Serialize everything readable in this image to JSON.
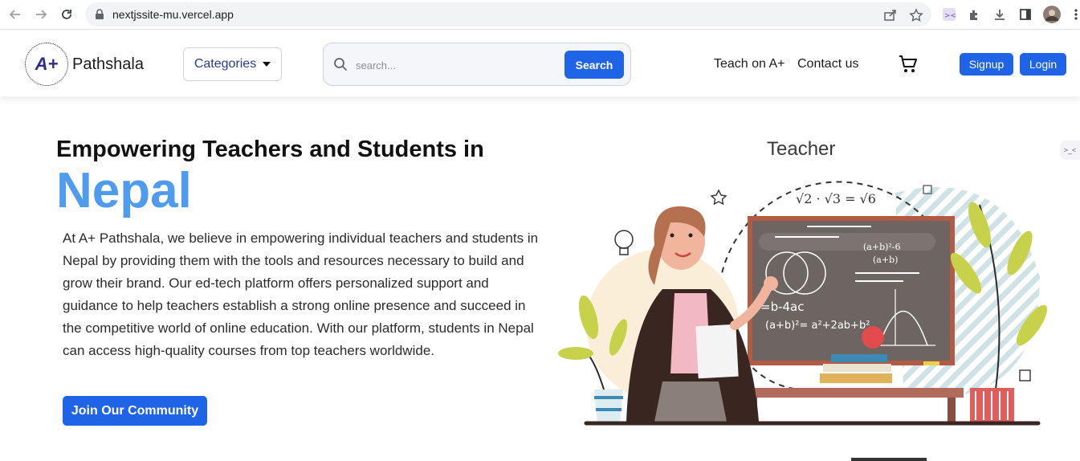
{
  "browser": {
    "url": "nextjssite-mu.vercel.app",
    "icons": [
      "back-icon",
      "forward-icon",
      "reload-icon",
      "lock-icon",
      "share-icon",
      "star-icon",
      "extension-icon",
      "puzzle-icon",
      "download-icon",
      "sidepanel-icon",
      "profile-avatar",
      "menu-icon"
    ]
  },
  "header": {
    "logo_text": "A+",
    "brand": "Pathshala",
    "categories_label": "Categories",
    "search_placeholder": "search...",
    "search_button": "Search",
    "nav": {
      "teach": "Teach on A+",
      "contact": "Contact us"
    },
    "signup": "Signup",
    "login": "Login"
  },
  "hero": {
    "title": "Empowering Teachers and Students in",
    "accent": "Nepal",
    "paragraph": "At A+ Pathshala, we believe in empowering individual teachers and students in Nepal by providing them with the tools and resources necessary to build and grow their brand. Our ed-tech platform offers personalized support and guidance to help teachers establish a strong online presence and succeed in the competitive world of online education. With our platform, students in Nepal can access high-quality courses from top teachers worldwide.",
    "cta": "Join Our Community"
  },
  "illustration": {
    "heading": "Teacher",
    "formula_top": "√2 · √3 = √6",
    "formula_board_1": "=b-4ac",
    "formula_board_2": "(a+b)²= a²+2ab+b²",
    "formula_board_3": "(a+b)²-6",
    "formula_board_4": "(a+b)"
  },
  "colors": {
    "primary": "#1f63e6",
    "accent": "#4f9bf0",
    "brand_navy": "#2f2a8f"
  }
}
